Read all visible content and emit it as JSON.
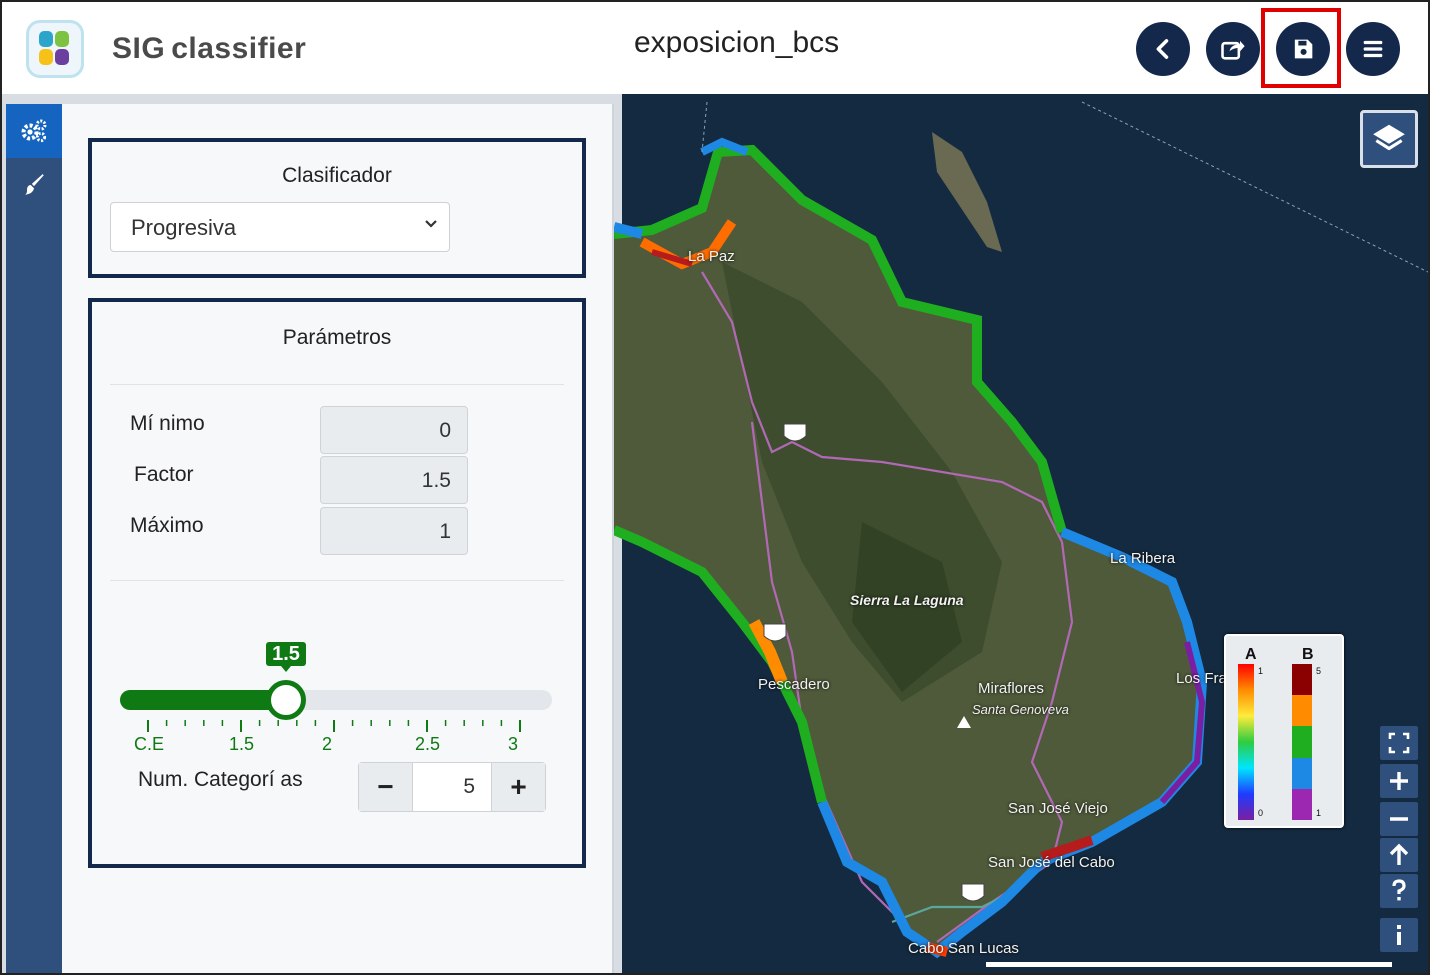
{
  "header": {
    "brand_sig": "SIG",
    "brand_classifier": "classifier",
    "document_title": "exposicion_bcs",
    "buttons": [
      {
        "name": "back-button",
        "icon": "chevron-left-icon"
      },
      {
        "name": "share-button",
        "icon": "share-export-icon"
      },
      {
        "name": "save-button",
        "icon": "floppy-disk-icon"
      },
      {
        "name": "menu-button",
        "icon": "hamburger-menu-icon"
      }
    ],
    "colors": {
      "button_bg": "#14284b",
      "highlight": "#e00000"
    }
  },
  "side_tabs": [
    {
      "name": "tab-settings",
      "icon": "gears-icon",
      "active": true
    },
    {
      "name": "tab-style",
      "icon": "paintbrush-icon",
      "active": false
    }
  ],
  "classifier": {
    "title": "Clasificador",
    "selected": "Progresiva"
  },
  "parameters": {
    "title": "Parámetros",
    "minimo_label": "Mí nimo",
    "minimo_value": "0",
    "factor_label": "Factor",
    "factor_value": "1.5",
    "maximo_label": "Máximo",
    "maximo_value": "1",
    "slider": {
      "value": 1.5,
      "value_label": "1.5",
      "min": 1,
      "max": 3,
      "tick_labels": [
        "C.E",
        "1.5",
        "2",
        "2.5",
        "3"
      ],
      "accent": "#0f7a14"
    },
    "num_categorias_label": "Num. Categorí as",
    "num_categorias_value": "5",
    "minus_label": "−",
    "plus_label": "+"
  },
  "map": {
    "labels": [
      "La Paz",
      "Sierra La Laguna",
      "Pescadero",
      "Miraflores",
      "Santa Genoveva",
      "San José Viejo",
      "San José del Cabo",
      "Los Frailes",
      "La Ribera",
      "Cabo San Lucas"
    ],
    "controls": [
      "fullscreen-icon",
      "zoom-in-icon",
      "zoom-out-icon",
      "north-arrow-icon",
      "help-icon",
      "info-icon"
    ]
  },
  "legend": {
    "col_a": "A",
    "col_b": "B",
    "a_top": "1",
    "a_bottom": "0",
    "b_top": "5",
    "b_bottom": "1",
    "b_colors": [
      "#8b0000",
      "#ff8c00",
      "#1fae1f",
      "#1e88e5",
      "#9c27b0"
    ]
  }
}
